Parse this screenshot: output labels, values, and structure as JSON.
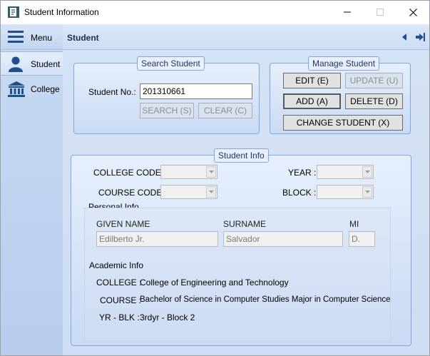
{
  "window": {
    "title": "Student Information",
    "minimize_glyph": "—",
    "maximize_glyph": "☐",
    "close_glyph": "✕"
  },
  "sidebar": {
    "items": [
      {
        "label": "Menu",
        "icon": "hamburger-menu-icon"
      },
      {
        "label": "Student",
        "icon": "user-icon"
      },
      {
        "label": "College",
        "icon": "institution-icon"
      }
    ]
  },
  "header": {
    "title": "Student",
    "icons": [
      "collapse-left-icon",
      "logout-icon"
    ]
  },
  "search": {
    "title": "Search Student",
    "student_no_label": "Student No.:",
    "student_no_value": "201310661",
    "search_button": "SEARCH (S)",
    "clear_button": "CLEAR (C)"
  },
  "manage": {
    "title": "Manage Student",
    "edit_button": "EDIT (E)",
    "update_button": "UPDATE (U)",
    "add_button": "ADD (A)",
    "delete_button": "DELETE (D)",
    "change_button": "CHANGE STUDENT (X)"
  },
  "info": {
    "title": "Student Info",
    "college_code_label": "COLLEGE CODE :",
    "year_label": "YEAR :",
    "course_code_label": "COURSE CODE:",
    "block_label": "BLOCK :",
    "personal_title": "Personal Info",
    "given_name_label": "GIVEN NAME",
    "surname_label": "SURNAME",
    "mi_label": "MI",
    "given_name_value": "Edilberto Jr.",
    "surname_value": "Salvador",
    "mi_value": "D.",
    "academic_title": "Academic Info",
    "college_label": "COLLEGE :",
    "college_value": "College of Engineering and Technology",
    "course_label": "COURSE :",
    "course_value": "Bachelor of Science in Computer Studies Major in Computer Science",
    "yrblk_label": "YR - BLK :",
    "yrblk_value": "3rdyr - Block 2"
  },
  "colors": {
    "accent": "#1f5fa8",
    "group_border": "#7fa7e0",
    "sidebar_bg": "#c8daf2",
    "main_bg": "#d5e2f5"
  }
}
